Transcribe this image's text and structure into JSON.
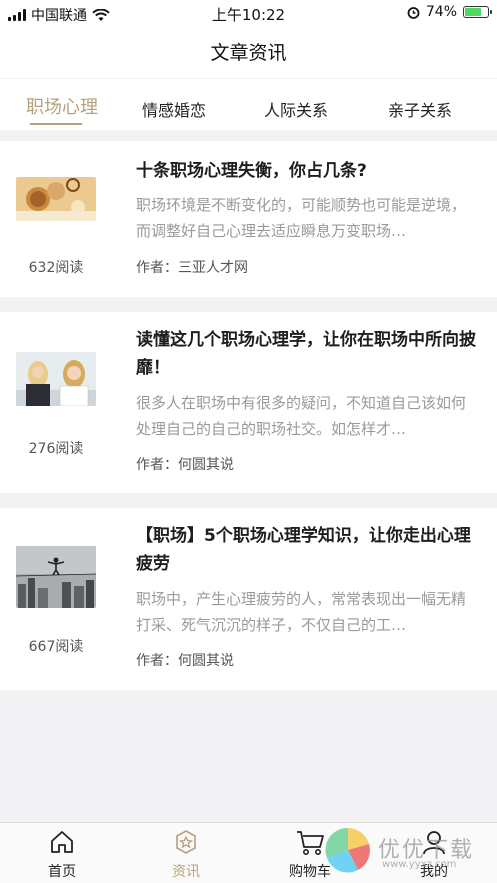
{
  "status_bar": {
    "carrier": "中国联通",
    "time": "上午10:22",
    "battery": "74%",
    "battery_level": 0.74
  },
  "nav": {
    "title": "文章资讯"
  },
  "tabs": [
    {
      "label": "职场心理",
      "active": true
    },
    {
      "label": "情感婚恋",
      "active": false
    },
    {
      "label": "人际关系",
      "active": false
    },
    {
      "label": "亲子关系",
      "active": false
    }
  ],
  "articles": [
    {
      "title": "十条职场心理失衡，你占几条?",
      "summary": "职场环境是不断变化的，可能顺势也可能是逆境，而调整好自己心理去适应瞬息万变职场…",
      "author_label": "作者：",
      "author": "三亚人才网",
      "reads": "632阅读",
      "thumb": "coins-photo"
    },
    {
      "title": "读懂这几个职场心理学，让你在职场中所向披靡！",
      "summary": "很多人在职场中有很多的疑问，不知道自己该如何处理自己的自己的职场社交。如怎样才…",
      "author_label": "作者：",
      "author": "何圆其说",
      "reads": "276阅读",
      "thumb": "office-women-photo"
    },
    {
      "title": "【职场】5个职场心理学知识，让你走出心理疲劳",
      "summary": "职场中，产生心理疲劳的人，常常表现出一幅无精打采、死气沉沉的样子，不仅自己的工…",
      "author_label": "作者：",
      "author": "何圆其说",
      "reads": "667阅读",
      "thumb": "tightrope-city-photo"
    }
  ],
  "tabbar": [
    {
      "label": "首页",
      "icon": "home-icon",
      "active": false
    },
    {
      "label": "资讯",
      "icon": "news-star-icon",
      "active": true
    },
    {
      "label": "购物车",
      "icon": "cart-icon",
      "active": false
    },
    {
      "label": "我的",
      "icon": "user-icon",
      "active": false
    }
  ],
  "watermark": {
    "text": "优优下载",
    "sub": "www.yyxz.com"
  },
  "colors": {
    "accent": "#b8a17a",
    "background": "#f2f2f4"
  }
}
